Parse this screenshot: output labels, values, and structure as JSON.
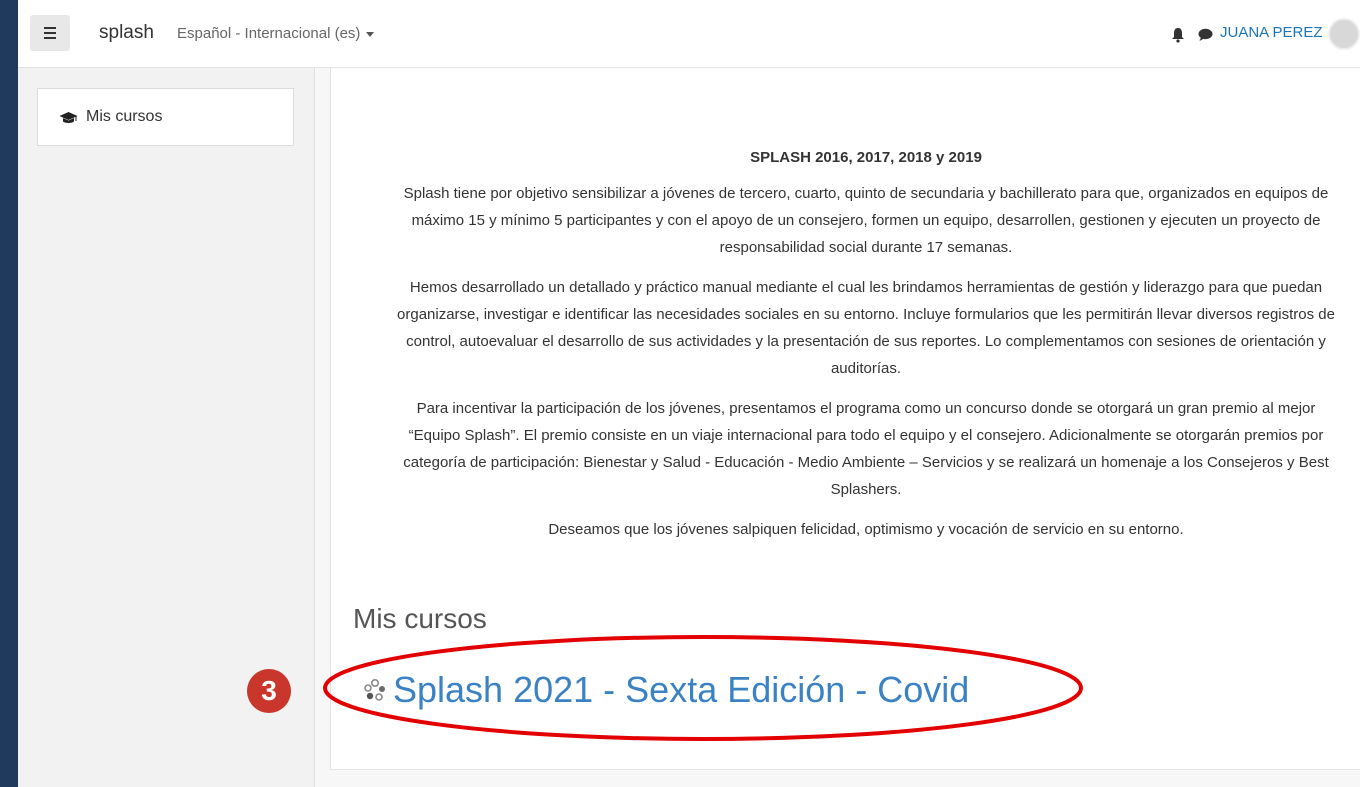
{
  "navbar": {
    "brand": "splash",
    "language": "Español - Internacional (es)",
    "username": "JUANA PEREZ",
    "icons": [
      "hamburger-icon",
      "bell-icon",
      "chat-icon",
      "avatar"
    ]
  },
  "drawer": {
    "items": [
      {
        "label": "Mis cursos",
        "icon": "graduation-cap-icon"
      }
    ]
  },
  "summary": {
    "heading": "SPLASH 2016, 2017, 2018 y 2019",
    "paragraphs": [
      "Splash tiene por objetivo sensibilizar a jóvenes de tercero, cuarto, quinto de secundaria y bachillerato para que, organizados en equipos de máximo 15 y mínimo 5 participantes y con el apoyo de un consejero, formen un equipo, desarrollen, gestionen y ejecuten un proyecto de responsabilidad social durante 17 semanas.",
      "Hemos desarrollado un detallado y práctico manual mediante el cual les brindamos herramientas de gestión y liderazgo para que puedan organizarse, investigar e identificar las necesidades sociales en su entorno. Incluye formularios que les permitirán llevar diversos registros de control, autoevaluar el desarrollo de sus actividades y la presentación de sus reportes. Lo complementamos con sesiones de orientación y auditorías.",
      "Para incentivar la participación de los jóvenes, presentamos el programa como un concurso donde se otorgará un gran premio al mejor “Equipo Splash”. El premio consiste en un viaje internacional para todo el equipo y el consejero.  Adicionalmente se otorgarán premios por categoría de participación: Bienestar y Salud - Educación - Medio Ambiente – Servicios y se realizará un homenaje a los Consejeros y Best Splashers.",
      "Deseamos que los jóvenes salpiquen felicidad, optimismo y vocación de servicio en su entorno."
    ]
  },
  "courses": {
    "section_title": "Mis cursos",
    "items": [
      {
        "name": "Splash 2021 - Sexta Edición - Covid",
        "icon": "course-icon"
      }
    ]
  },
  "annotation": {
    "step_number": "3",
    "color": "#c9372c",
    "ellipse_color": "#e30000"
  }
}
